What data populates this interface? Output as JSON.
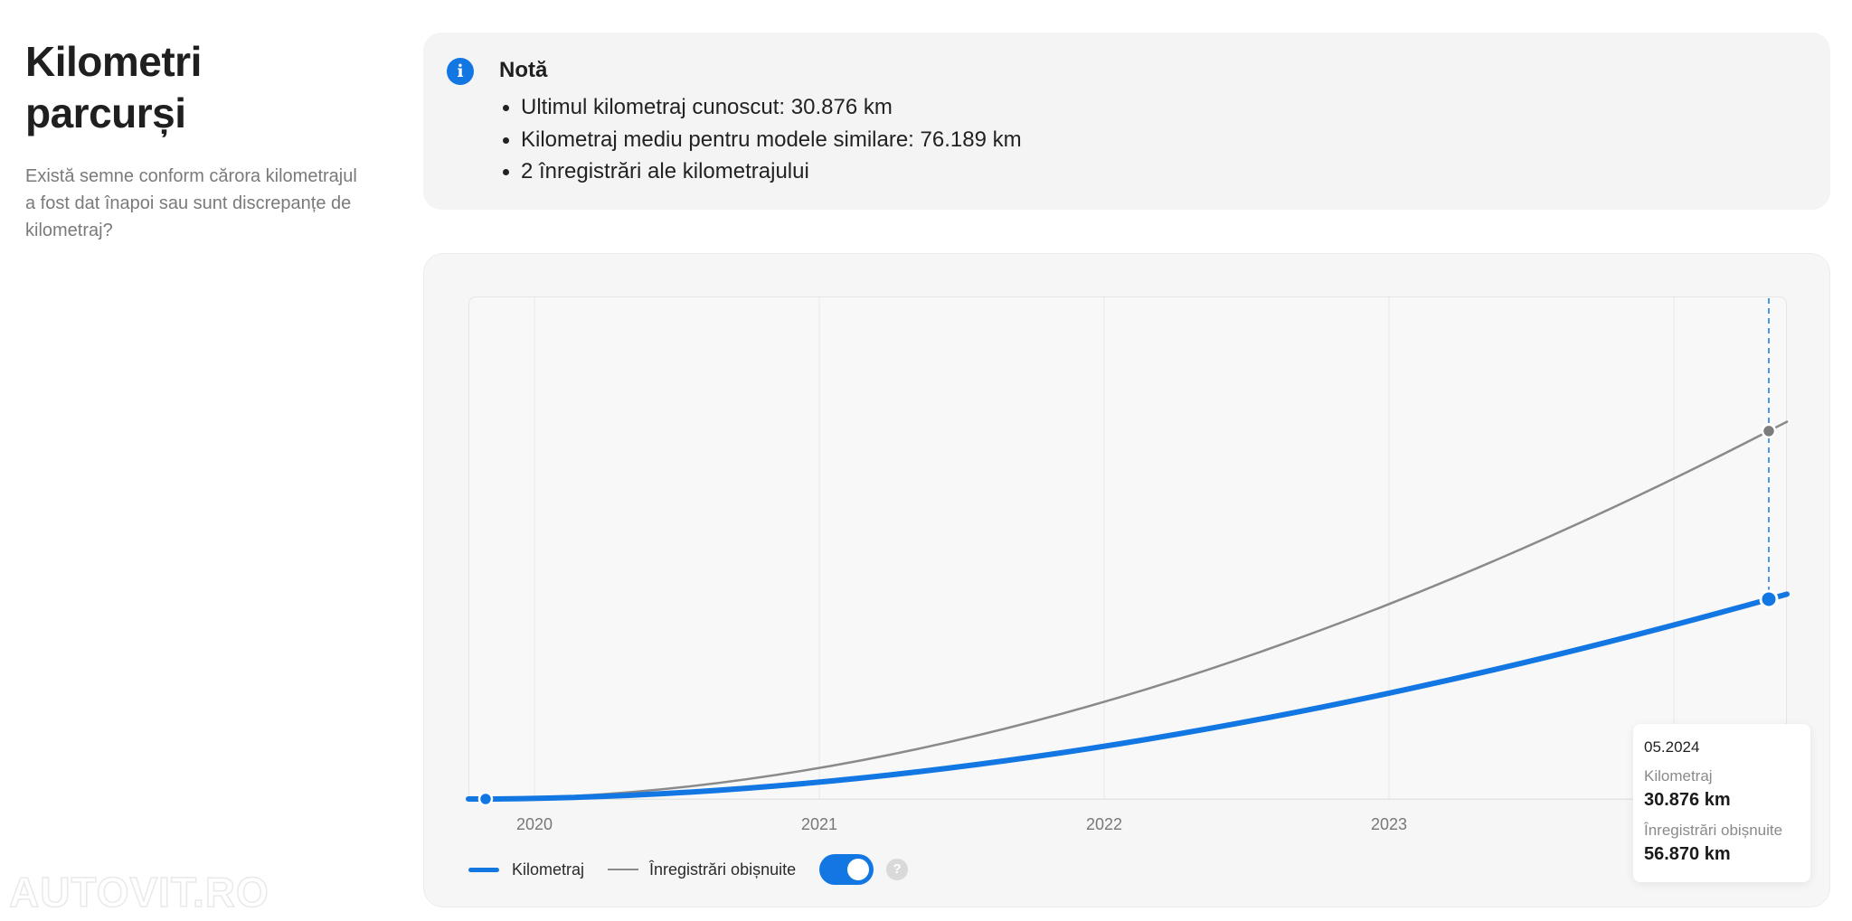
{
  "section": {
    "title_line1": "Kilometri",
    "title_line2": "parcurși",
    "subtitle": "Există semne conform cărora kilometrajul a fost dat înapoi sau sunt discrepanțe de kilometraj?"
  },
  "note": {
    "icon": "info-icon",
    "icon_glyph": "i",
    "title": "Notă",
    "items": [
      "Ultimul kilometraj cunoscut: 30.876 km",
      "Kilometraj mediu pentru modele similare: 76.189 km",
      "2 înregistrări ale kilometrajului"
    ]
  },
  "chart_data": {
    "type": "line",
    "x_ticks": [
      "2020",
      "2021",
      "2022",
      "2023"
    ],
    "series": [
      {
        "name": "Kilometraj",
        "color": "#1277e3",
        "points": [
          {
            "x": "2019-10",
            "y": 0
          },
          {
            "x": "2024-05",
            "y": 30876
          }
        ]
      },
      {
        "name": "Înregistrări obișnuite",
        "color": "#8a8a8a",
        "points": [
          {
            "x": "2019-10",
            "y": 0
          },
          {
            "x": "2024-05",
            "y": 56870
          }
        ]
      }
    ],
    "grid": true,
    "legend_position": "bottom-left",
    "tooltip": {
      "date": "05.2024",
      "label1": "Kilometraj",
      "value1": "30.876 km",
      "label2": "Înregistrări obișnuite",
      "value2": "56.870 km"
    }
  },
  "legend": {
    "item1": "Kilometraj",
    "item2": "Înregistrări obișnuite",
    "toggle_on": true,
    "help_glyph": "?"
  },
  "watermark": "AUTOVIT.RO"
}
